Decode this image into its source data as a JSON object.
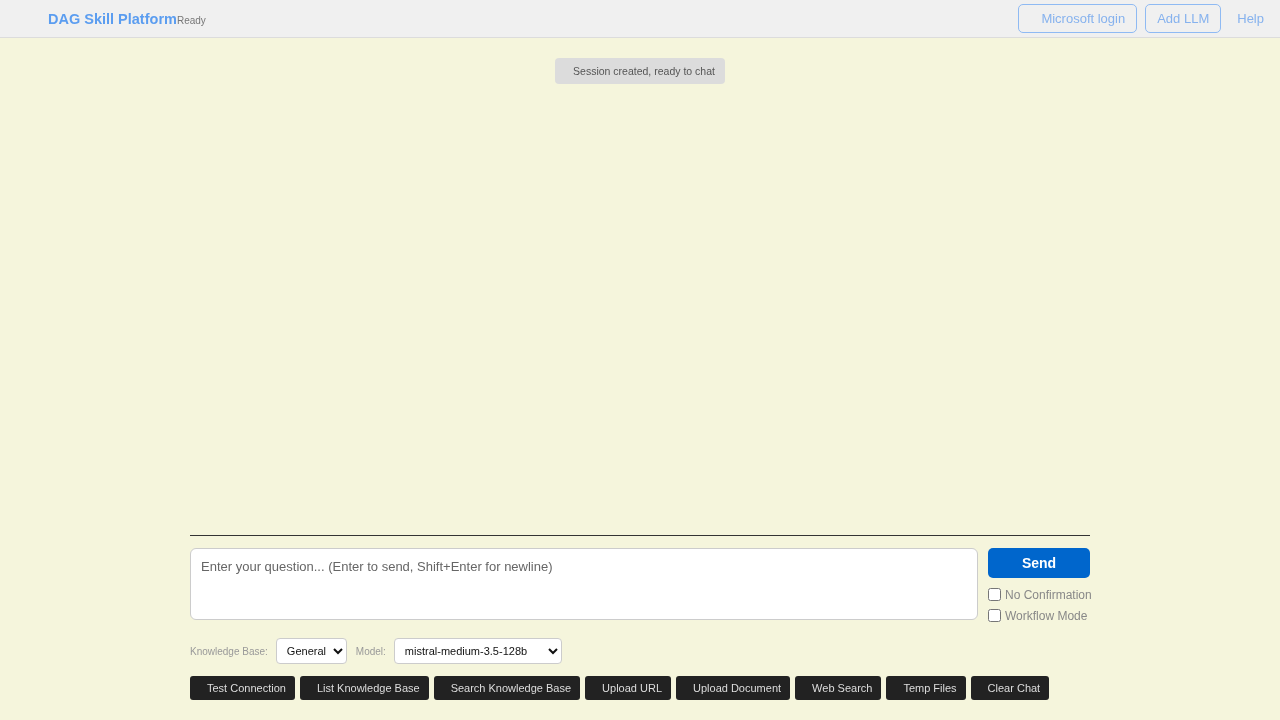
{
  "header": {
    "title": "DAG Skill Platform",
    "status": "Ready",
    "buttons": [
      {
        "label": "Microsoft login",
        "kind": "outline"
      },
      {
        "label": "Add LLM",
        "kind": "outline"
      },
      {
        "label": "Help",
        "kind": "link"
      }
    ]
  },
  "messages": [
    {
      "kind": "system",
      "text": "Session created, ready to chat"
    }
  ],
  "composer": {
    "placeholder": "Enter your question... (Enter to send, Shift+Enter for newline)",
    "send_label": "Send",
    "options": [
      {
        "label": "No Confirmation",
        "checked": false
      },
      {
        "label": "Workflow Mode",
        "checked": false
      }
    ]
  },
  "selectors": [
    {
      "label": "Knowledge Base:",
      "value": "General"
    },
    {
      "label": "Model:",
      "value": "mistral-medium-3.5-128b"
    }
  ],
  "actions": [
    "Test Connection",
    "List Knowledge Base",
    "Search Knowledge Base",
    "Upload URL",
    "Upload Document",
    "Web Search",
    "Temp Files",
    "Clear Chat"
  ]
}
